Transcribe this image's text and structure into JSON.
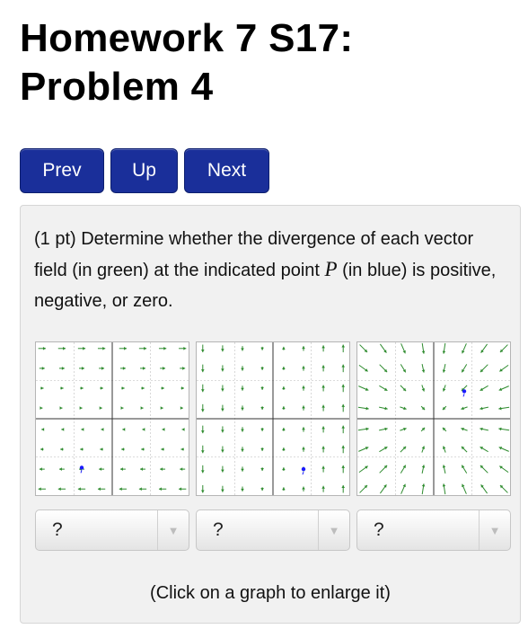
{
  "header": {
    "title_line1": "Homework 7 S17:",
    "title_line2": "Problem 4"
  },
  "nav": {
    "prev_label": "Prev",
    "up_label": "Up",
    "next_label": "Next"
  },
  "problem": {
    "statement_part1": "(1 pt) Determine whether the divergence of each vector field (in green) at the indicated point ",
    "point_var": "P",
    "statement_part2": " (in blue) is positive, negative, or zero.",
    "hint": "(Click on a graph to enlarge it)"
  },
  "graphs": [
    {
      "name": "field-1",
      "field": "horizontal",
      "point_quadrant": "lower-left"
    },
    {
      "name": "field-2",
      "field": "vertical",
      "point_quadrant": "lower-right"
    },
    {
      "name": "field-3",
      "field": "radial",
      "point_quadrant": "upper-right"
    }
  ],
  "answers": [
    {
      "selected": "?"
    },
    {
      "selected": "?"
    },
    {
      "selected": "?"
    }
  ],
  "colors": {
    "vector": "#2e8b2e",
    "point": "#1a1aff",
    "nav_button": "#1a2f9a",
    "panel": "#f1f1f1"
  }
}
